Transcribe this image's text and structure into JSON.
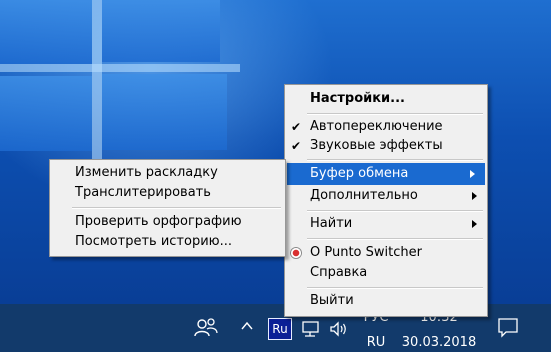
{
  "taskbar": {
    "ime_badge": "Ru",
    "language": {
      "line1": "РУС",
      "line2": "RU"
    },
    "clock": {
      "time": "10:32",
      "date": "30.03.2018"
    },
    "icons": [
      "people-icon",
      "chevron-up-icon",
      "network-icon",
      "volume-icon",
      "notification-icon"
    ]
  },
  "context_menu": {
    "items": [
      {
        "label": "Настройки...",
        "bold": true
      },
      {
        "label": "Автопереключение",
        "checked": true
      },
      {
        "label": "Звуковые эффекты",
        "checked": true
      },
      {
        "label": "Буфер обмена",
        "submenu": true,
        "highlighted": true
      },
      {
        "label": "Дополнительно",
        "submenu": true
      },
      {
        "label": "Найти",
        "submenu": true
      },
      {
        "label": "О Punto Switcher",
        "icon": "punto-switcher-icon"
      },
      {
        "label": "Справка"
      },
      {
        "label": "Выйти"
      }
    ]
  },
  "clipboard_submenu": {
    "items": [
      {
        "label": "Изменить раскладку"
      },
      {
        "label": "Транслитерировать"
      },
      {
        "label": "Проверить орфографию"
      },
      {
        "label": "Посмотреть историю..."
      }
    ]
  },
  "colors": {
    "highlight": "#1a6ad0",
    "taskbar": "#123a6b",
    "menu_bg": "#f0f0f0",
    "desktop": "#0d4fb1"
  }
}
